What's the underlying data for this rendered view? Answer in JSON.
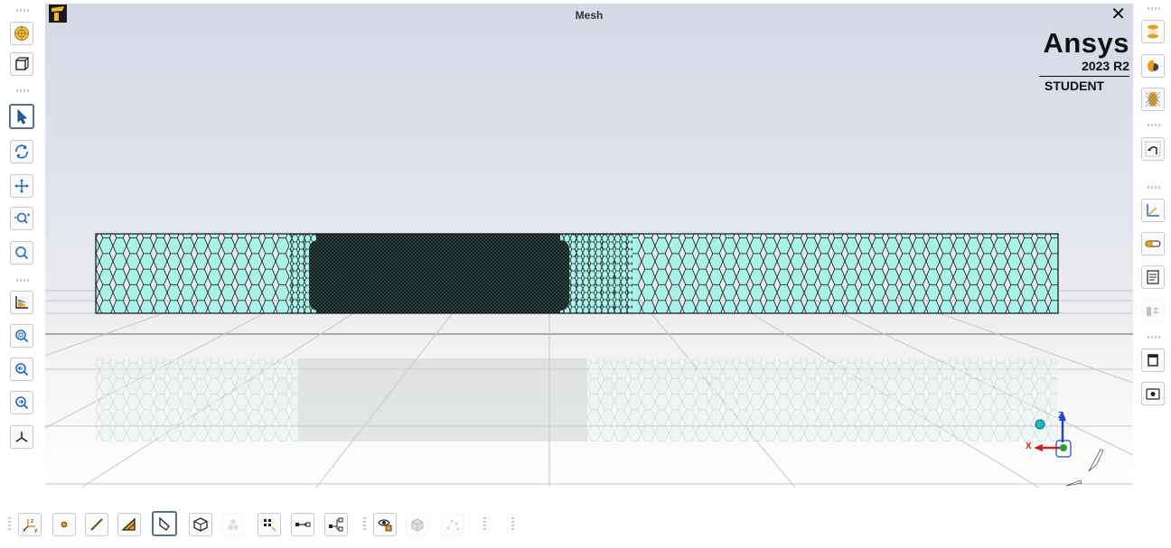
{
  "viewport": {
    "title": "Mesh"
  },
  "branding": {
    "product": "Ansys",
    "version": "2023 R2",
    "edition": "STUDENT"
  },
  "triad": {
    "x_label": "X",
    "z_label": "Z"
  },
  "left_toolbar": {
    "buttons": [
      "mesh-display-icon",
      "view-box-icon",
      "select-cursor-icon",
      "rotate-icon",
      "pan-icon",
      "zoom-icon",
      "zoom-box-icon",
      "fit-icon",
      "magnify-icon",
      "previous-view-icon",
      "next-view-icon",
      "isometric-view-icon"
    ]
  },
  "right_toolbar": {
    "buttons": [
      "cross-section-icon",
      "show-mesh-icon",
      "wireframe-icon",
      "reset-view-icon",
      "coordinate-axes-icon",
      "ruler-icon",
      "legend-icon",
      "hide-tree-icon",
      "display-frame-icon",
      "screenshot-icon"
    ]
  },
  "bottom_toolbar": {
    "buttons": [
      "axis-orientation-icon",
      "vertex-select-icon",
      "edge-select-icon",
      "face-select-icon",
      "body-select-icon",
      "element-face-select-icon",
      "element-select-icon",
      "node-select-icon",
      "extend-select-icon",
      "box-select-icon",
      "show-vertices-icon",
      "show-all-bodies-icon",
      "show-node-icon"
    ]
  },
  "colors": {
    "mesh_fill": "#aaf2e9",
    "mesh_edge": "#1b2b2b",
    "background_top": "#d5d9e6",
    "axis_x": "#d22020",
    "axis_z": "#2040d0",
    "axis_y": "#20a040"
  }
}
